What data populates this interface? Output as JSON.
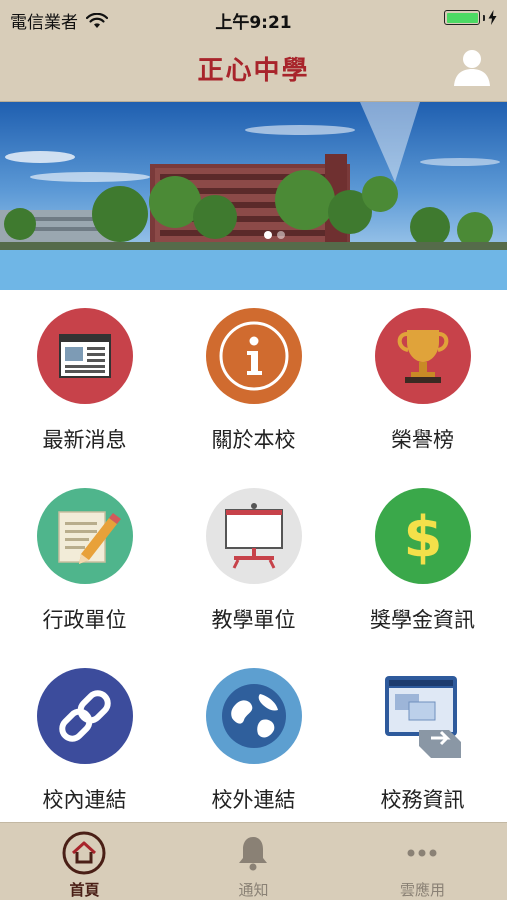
{
  "status": {
    "carrier": "電信業者",
    "time": "上午9:21"
  },
  "header": {
    "title": "正心中學"
  },
  "banner": {
    "slides": 2,
    "active_slide": 1
  },
  "menu": [
    {
      "label": "最新消息",
      "icon": "newspaper-icon",
      "color": "#c7424a"
    },
    {
      "label": "關於本校",
      "icon": "info-icon",
      "color": "#d06b2f"
    },
    {
      "label": "榮譽榜",
      "icon": "trophy-icon",
      "color": "#c7424a"
    },
    {
      "label": "行政單位",
      "icon": "pencil-note-icon",
      "color": "#4fb58c"
    },
    {
      "label": "教學單位",
      "icon": "whiteboard-icon",
      "color": "#e4e4e4"
    },
    {
      "label": "獎學金資訊",
      "icon": "dollar-icon",
      "color": "#3aa84a"
    },
    {
      "label": "校內連結",
      "icon": "link-icon",
      "color": "#3c4c9c"
    },
    {
      "label": "校外連結",
      "icon": "globe-icon",
      "color": "#5d9fd0"
    },
    {
      "label": "校務資訊",
      "icon": "window-app-icon",
      "color": "#2e5a9c"
    }
  ],
  "tabs": [
    {
      "label": "首頁",
      "icon": "home-icon"
    },
    {
      "label": "通知",
      "icon": "bell-icon"
    },
    {
      "label": "雲應用",
      "icon": "more-icon"
    }
  ]
}
